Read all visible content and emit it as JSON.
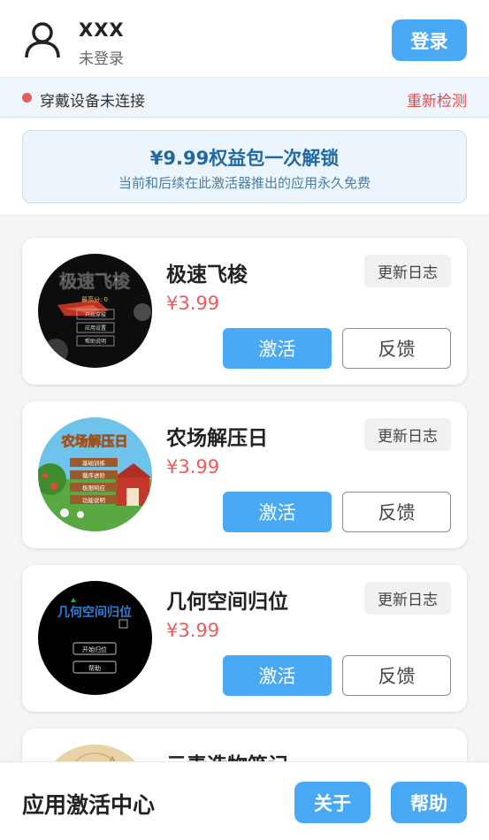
{
  "header": {
    "username": "XXX",
    "login_status": "未登录",
    "login_button": "登录"
  },
  "device": {
    "status_text": "穿戴设备未连接",
    "recheck_label": "重新检测",
    "status_color": "#ee5b5b"
  },
  "promo": {
    "title": "¥9.99权益包一次解锁",
    "subtitle": "当前和后续在此激活器推出的应用永久免费"
  },
  "apps": [
    {
      "name": "极速飞梭",
      "price": "¥3.99",
      "log_label": "更新日志",
      "activate_label": "激活",
      "feedback_label": "反馈",
      "thumb": {
        "title": "极速飞梭",
        "score": "最高分: 0",
        "menu": [
          "开始穿梭",
          "应用设置",
          "帮助说明"
        ]
      }
    },
    {
      "name": "农场解压日",
      "price": "¥3.99",
      "log_label": "更新日志",
      "activate_label": "激活",
      "feedback_label": "反馈",
      "thumb": {
        "title": "农场解压日",
        "menu": [
          "基础训练",
          "循序进阶",
          "极限响应",
          "功能说明"
        ]
      }
    },
    {
      "name": "几何空间归位",
      "price": "¥3.99",
      "log_label": "更新日志",
      "activate_label": "激活",
      "feedback_label": "反馈",
      "thumb": {
        "title": "几何空间归位",
        "menu": [
          "开始归位",
          "帮助"
        ]
      }
    },
    {
      "name": "元素造物笔记",
      "price": "",
      "log_label": "",
      "activate_label": "",
      "feedback_label": ""
    }
  ],
  "footer": {
    "title": "应用激活中心",
    "about_button": "关于",
    "help_button": "帮助"
  },
  "colors": {
    "accent": "#4aa9f5",
    "price": "#ee5b5b",
    "recheck": "#e24b4b",
    "promo_text": "#1f6aa5"
  }
}
